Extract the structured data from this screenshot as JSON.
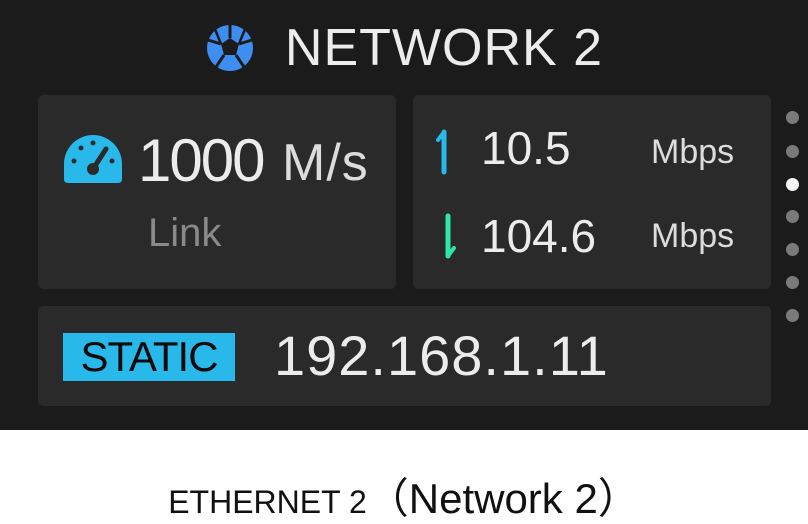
{
  "header": {
    "title": "NETWORK 2",
    "icon": "network-globe-icon",
    "icon_color": "#3d8ef0"
  },
  "speed_card": {
    "icon": "speedometer-icon",
    "icon_color": "#29b8ea",
    "value": "1000",
    "unit": "M/s",
    "label": "Link"
  },
  "traffic_card": {
    "upload": {
      "value": "10.5",
      "unit": "Mbps",
      "icon": "arrow-up-icon",
      "color": "#29b8ea"
    },
    "download": {
      "value": "104.6",
      "unit": "Mbps",
      "icon": "arrow-down-icon",
      "color": "#2ee6a8"
    }
  },
  "ip_card": {
    "mode": "STATIC",
    "mode_color": "#29b8ea",
    "address": "192.168.1.11"
  },
  "pager": {
    "total": 7,
    "active_index": 2
  },
  "caption": {
    "main": "ETHERNET 2",
    "paren": "（Network 2）"
  }
}
